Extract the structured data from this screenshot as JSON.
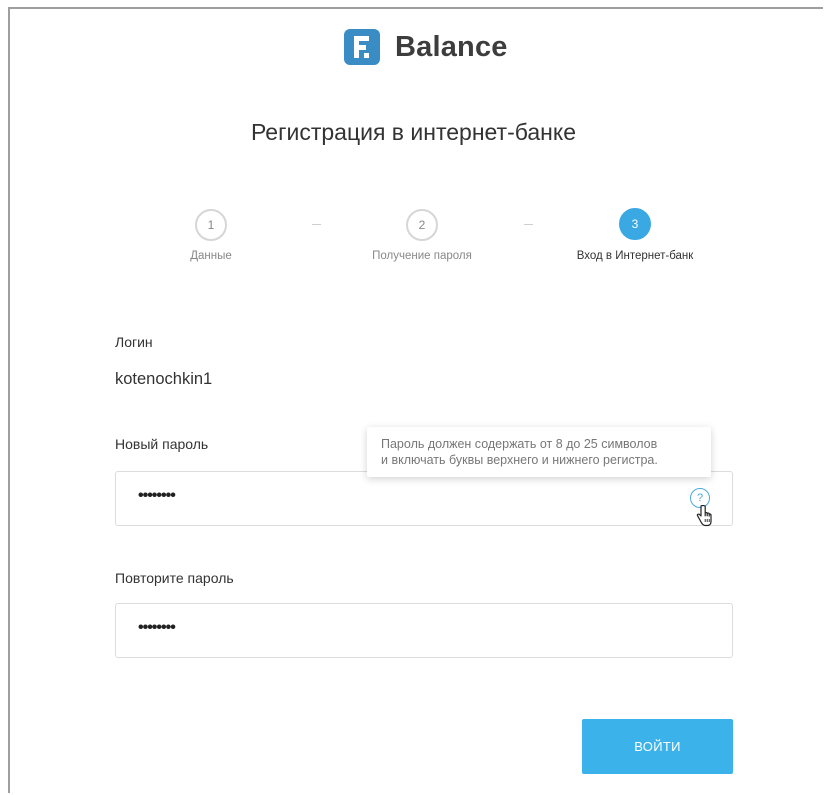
{
  "brand": {
    "name": "Balance",
    "color": "#3a8dc4"
  },
  "title": "Регистрация в интернет-банке",
  "steps": [
    {
      "number": "1",
      "label": "Данные",
      "active": false
    },
    {
      "number": "2",
      "label": "Получение пароля",
      "active": false
    },
    {
      "number": "3",
      "label": "Вход в Интернет-банк",
      "active": true
    }
  ],
  "login": {
    "label": "Логин",
    "value": "kotenochkin1"
  },
  "new_password": {
    "label": "Новый пароль",
    "masked_value": "••••••••",
    "help_icon": "question-circle-icon"
  },
  "tooltip": {
    "line1": "Пароль должен содержать от 8 до 25 символов",
    "line2": "и включать буквы верхнего и нижнего регистра."
  },
  "repeat_password": {
    "label": "Повторите пароль",
    "masked_value": "••••••••"
  },
  "submit": {
    "label": "ВОЙТИ",
    "color": "#3bb3ea"
  },
  "accent_color": "#3aa8e2"
}
